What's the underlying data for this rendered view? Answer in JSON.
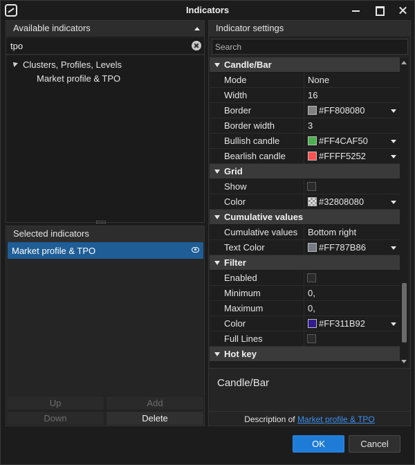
{
  "window": {
    "title": "Indicators"
  },
  "available": {
    "header": "Available indicators",
    "search_value": "tpo",
    "tree": {
      "group": "Clusters, Profiles, Levels",
      "item": "Market profile & TPO"
    }
  },
  "selected": {
    "header": "Selected indicators",
    "items": [
      {
        "label": "Market profile & TPO"
      }
    ],
    "buttons": {
      "up": "Up",
      "add": "Add",
      "down": "Down",
      "delete": "Delete"
    }
  },
  "settings": {
    "header": "Indicator settings",
    "search_placeholder": "Search",
    "categories": {
      "candle": {
        "label": "Candle/Bar",
        "mode": {
          "label": "Mode",
          "value": "None"
        },
        "width": {
          "label": "Width",
          "value": "16"
        },
        "border": {
          "label": "Border",
          "value": "#FF808080",
          "color": "#808080"
        },
        "border_width": {
          "label": "Border width",
          "value": "3"
        },
        "bullish": {
          "label": "Bullish candle",
          "value": "#FF4CAF50",
          "color": "#4CAF50"
        },
        "bearish": {
          "label": "Bearlish candle",
          "value": "#FFFF5252",
          "color": "#FF5252"
        }
      },
      "grid": {
        "label": "Grid",
        "show": {
          "label": "Show",
          "checked": false
        },
        "color": {
          "label": "Color",
          "value": "#32808080"
        }
      },
      "cumulative": {
        "label": "Cumulative values",
        "values": {
          "label": "Cumulative values",
          "value": "Bottom right"
        },
        "text_color": {
          "label": "Text Color",
          "value": "#FF787B86",
          "color": "#787B86"
        }
      },
      "filter": {
        "label": "Filter",
        "enabled": {
          "label": "Enabled",
          "checked": false
        },
        "minimum": {
          "label": "Minimum",
          "value": "0,"
        },
        "maximum": {
          "label": "Maximum",
          "value": "0,"
        },
        "color": {
          "label": "Color",
          "value": "#FF311B92",
          "color": "#311B92"
        },
        "full_lines": {
          "label": "Full Lines",
          "checked": false
        }
      },
      "hotkey": {
        "label": "Hot key"
      }
    },
    "description": {
      "title": "Candle/Bar",
      "prefix": "Description of",
      "link": "Market profile & TPO"
    }
  },
  "footer": {
    "ok": "OK",
    "cancel": "Cancel"
  }
}
